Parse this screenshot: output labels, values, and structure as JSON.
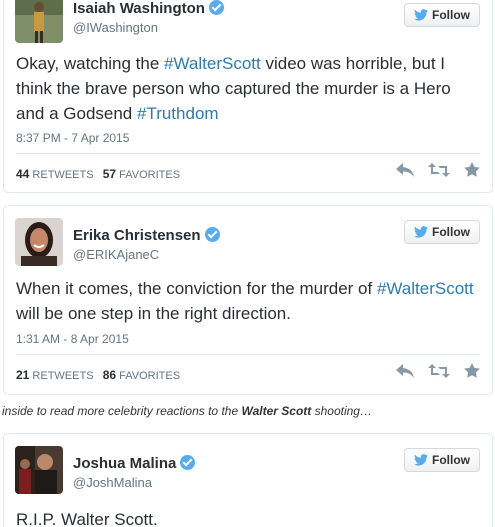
{
  "tweets": [
    {
      "name": "Isaiah Washington",
      "handle": "@IWashington",
      "follow_label": "Follow",
      "text_parts": [
        "Okay, watching the ",
        "#WalterScott",
        " video was horrible, but I think the brave person who captured the murder is a Hero and a Godsend ",
        "#Truthdom"
      ],
      "timestamp": "8:37 PM - 7 Apr 2015",
      "retweets_count": "44",
      "retweets_label": "RETWEETS",
      "favorites_count": "57",
      "favorites_label": "FAVORITES"
    },
    {
      "name": "Erika Christensen",
      "handle": "@ERIKAjaneC",
      "follow_label": "Follow",
      "text_parts": [
        "When it comes, the conviction for the murder of ",
        "#WalterScott",
        " will be one step in the right direction."
      ],
      "timestamp": "1:31 AM - 8 Apr 2015",
      "retweets_count": "21",
      "retweets_label": "RETWEETS",
      "favorites_count": "86",
      "favorites_label": "FAVORITES"
    },
    {
      "name": "Joshua Malina",
      "handle": "@JoshMalina",
      "follow_label": "Follow",
      "text": "R.I.P. Walter Scott."
    }
  ],
  "caption": {
    "before": "inside to read more celebrity reactions to the ",
    "bold": "Walter Scott",
    "after": " shooting…"
  },
  "colors": {
    "hashtag": "#2b7bb9",
    "verified": "#55acee",
    "twitter_bird": "#55acee",
    "muted": "#66757f",
    "icon": "#8899a6"
  },
  "icons": [
    "verified-badge-icon",
    "twitter-bird-icon",
    "reply-icon",
    "retweet-icon",
    "favorite-star-icon"
  ]
}
